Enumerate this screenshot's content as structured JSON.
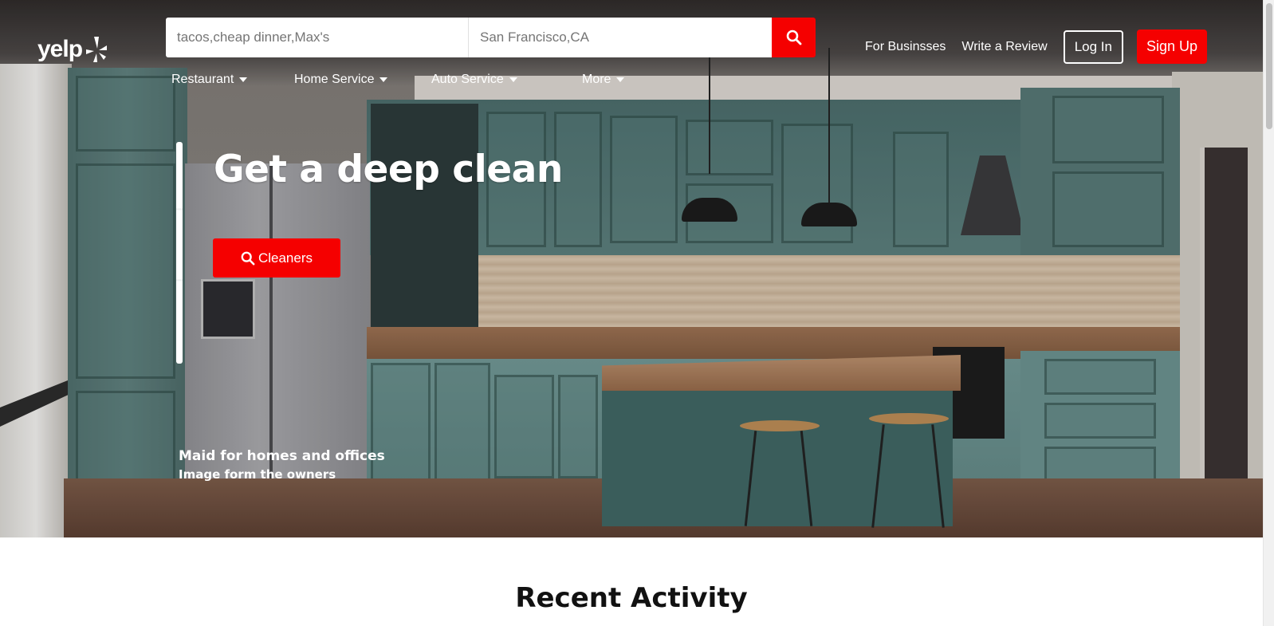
{
  "header": {
    "logo_text": "yelp",
    "search_placeholder": "tacos,cheap dinner,Max's",
    "location_placeholder": "San Francisco,CA",
    "links": {
      "for_business": "For Businsses",
      "write_review": "Write a Review"
    },
    "login_label": "Log In",
    "signup_label": "Sign Up"
  },
  "categories": [
    {
      "label": "Restaurant"
    },
    {
      "label": "Home Service"
    },
    {
      "label": "Auto Service"
    },
    {
      "label": "More"
    }
  ],
  "hero": {
    "title": "Get a deep clean",
    "cta_label": "Cleaners",
    "caption": "Maid for homes and offices",
    "caption_sub": "Image form the owners"
  },
  "recent": {
    "title": "Recent Activity"
  },
  "colors": {
    "brand_red": "#f50000",
    "text_dark": "#111111"
  },
  "icons": {
    "search": "search-icon",
    "logo_burst": "yelp-burst-icon",
    "caret": "caret-down-icon"
  }
}
